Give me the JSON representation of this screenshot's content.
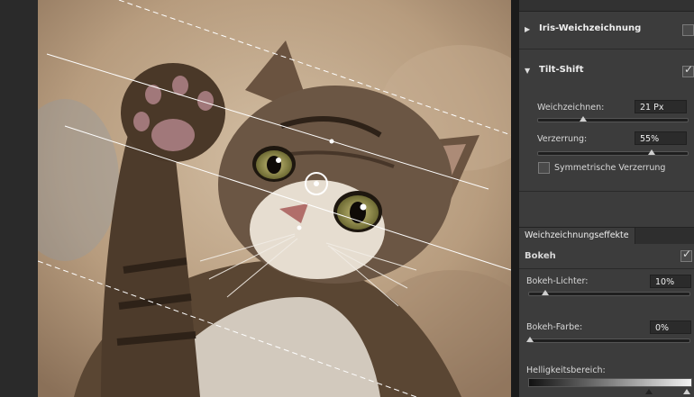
{
  "canvas": {
    "alt": "kitten raising paw with tilt-shift blur overlay",
    "accent_colors": {
      "line": "#ffffff",
      "background_tone": "#b79c7e"
    }
  },
  "panel": {
    "iris": {
      "label": "Iris-Weichzeichnung",
      "checked": false
    },
    "tilt_shift": {
      "label": "Tilt-Shift",
      "checked": true,
      "blur_label": "Weichzeichnen:",
      "blur_value": "21 Px",
      "distortion_label": "Verzerrung:",
      "distortion_value": "55%",
      "symmetric_label": "Symmetrische Verzerrung",
      "symmetric_checked": false
    },
    "effects_tab": "Weichzeichnungseffekte",
    "bokeh": {
      "label": "Bokeh",
      "checked": true,
      "lights_label": "Bokeh-Lichter:",
      "lights_value": "10%",
      "color_label": "Bokeh-Farbe:",
      "color_value": "0%",
      "range_label": "Helligkeitsbereich:"
    }
  }
}
